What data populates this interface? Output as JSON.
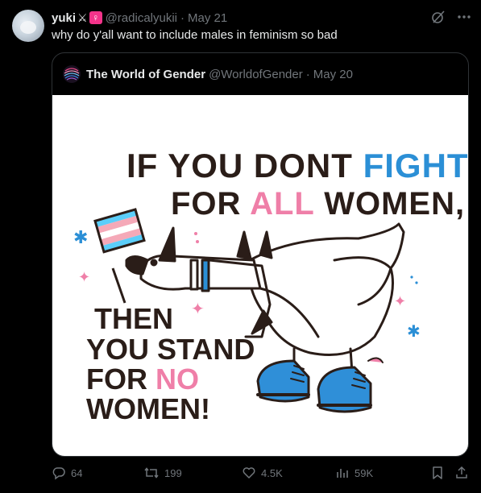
{
  "post": {
    "author_name": "yuki",
    "author_handle": "@radicalyukii",
    "separator": "·",
    "date": "May 21",
    "emoji_x": "⚔",
    "emoji_venus": "♀",
    "text": "why do y'all want to include males in feminism so bad"
  },
  "quote": {
    "author_name": "The World of Gender",
    "author_handle": "@WorldofGender",
    "separator": "·",
    "date": "May 20",
    "image": {
      "line1_a": "IF YOU DONT ",
      "line1_b": "FIGHT",
      "line2_a": "FOR ",
      "line2_b": "ALL",
      "line2_c": " WOMEN,",
      "line3": "THEN",
      "line4": "YOU STAND",
      "line5_a": "FOR ",
      "line5_b": "NO",
      "line6": "WOMEN!"
    }
  },
  "actions": {
    "replies": "64",
    "reposts": "199",
    "likes": "4.5K",
    "views": "59K"
  },
  "colors": {
    "accent_blue": "#2b8fd6",
    "accent_pink": "#ef7fa8",
    "text_dark": "#2a1d18",
    "muted": "#71767b"
  }
}
